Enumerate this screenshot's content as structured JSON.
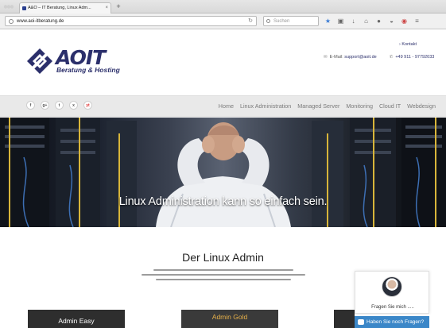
{
  "browser": {
    "tab_title": "A&O – IT Beratung, Linux Adm...",
    "tab_close": "×",
    "new_tab": "+",
    "url": "www.aoi-itberatung.de",
    "search_placeholder": "Suchen",
    "toolbar_icons": [
      "star-icon",
      "clipboard-icon",
      "download-icon",
      "home-icon",
      "chat-icon",
      "mask-icon",
      "extension-icon",
      "hamburger-menu-icon"
    ]
  },
  "header": {
    "logo_text": "AOIT",
    "logo_tagline": "Beratung & Hosting",
    "kontakt_link": "› Kontakt",
    "email_label": "E-Mail:",
    "email": "support@aoit.de",
    "phone": "+49 911 - 97792033"
  },
  "social": [
    "f",
    "g+",
    "t",
    "x",
    "yt"
  ],
  "nav": {
    "items": [
      "Home",
      "Linux Administration",
      "Managed Server",
      "Monitoring",
      "Cloud IT",
      "Webdesign"
    ]
  },
  "hero": {
    "headline": "Linux Administration kann so einfach sein."
  },
  "content": {
    "title": "Der Linux Admin"
  },
  "plans": [
    {
      "name": "Admin Easy"
    },
    {
      "name": "Admin Gold"
    },
    {
      "name": ""
    }
  ],
  "chat": {
    "prompt": "Fragen Sie mich .....",
    "button": "Haben Sie noch Fragen?"
  },
  "colors": {
    "brand": "#2b2f6b",
    "gold": "#e6b04a",
    "chat_blue": "#3b87c8"
  }
}
